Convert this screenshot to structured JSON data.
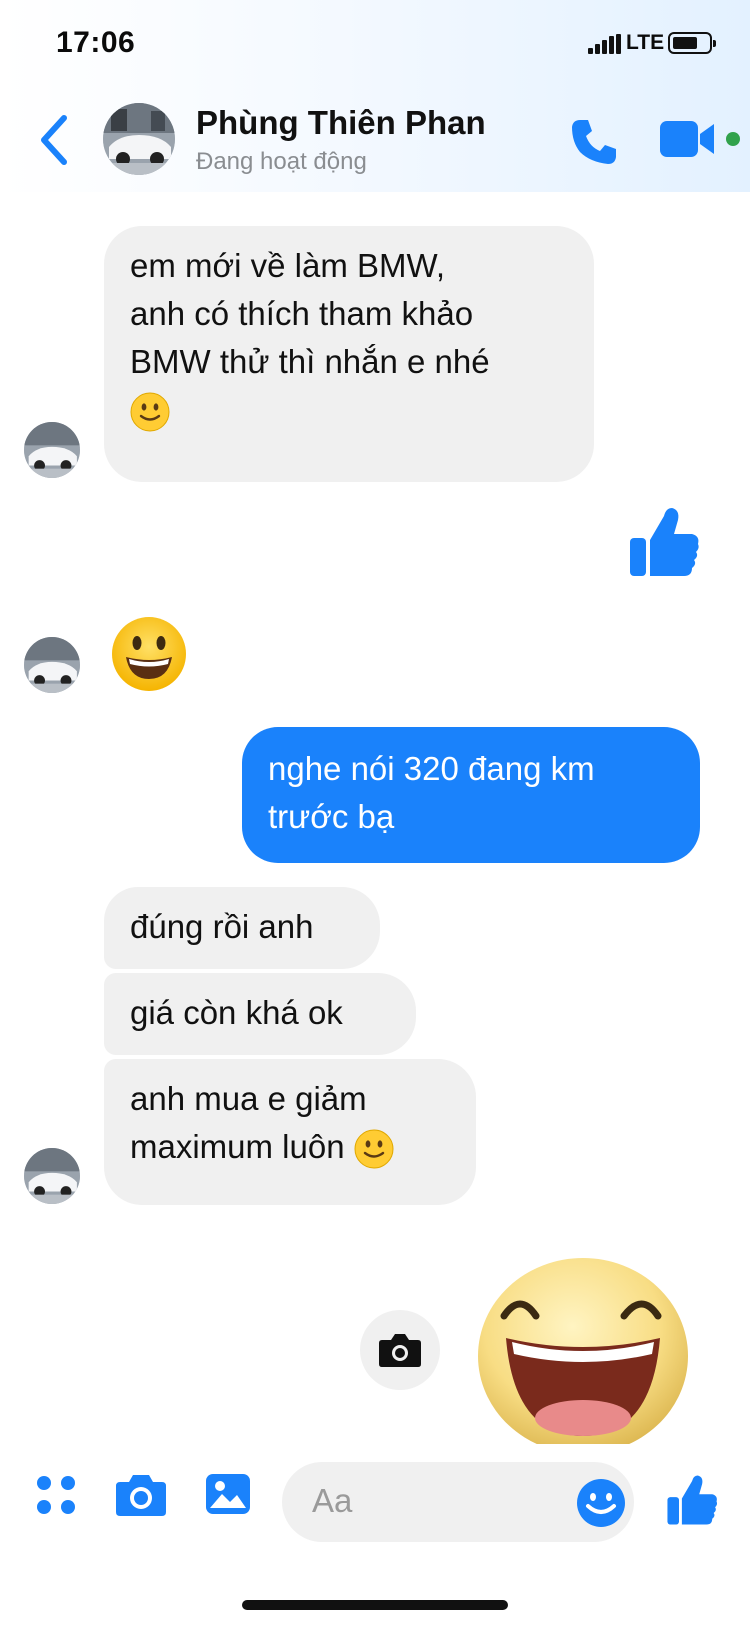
{
  "status": {
    "time": "17:06",
    "network": "LTE"
  },
  "header": {
    "contact_name": "Phùng Thiên Phan",
    "presence": "Đang hoạt động"
  },
  "messages": {
    "m1": [
      "em mới về làm BMW,",
      "anh có thích tham khảo",
      "BMW thử thì nhắn e nhé"
    ],
    "m2": [
      "nghe nói 320 đang km",
      "trước bạ"
    ],
    "m3": "đúng rồi anh",
    "m4": "giá còn khá ok",
    "m5": [
      "anh mua e giảm",
      "maximum luôn"
    ]
  },
  "composer": {
    "placeholder": "Aa"
  },
  "colors": {
    "accent": "#1a82fb",
    "incoming_bubble": "#f0f0f0",
    "online": "#31a24c"
  },
  "icons": [
    "back-chevron-icon",
    "phone-icon",
    "video-camera-icon",
    "slightly-smiling-emoji",
    "thumbs-up-icon",
    "grinning-emoji",
    "camera-icon",
    "menu-dots-icon",
    "image-icon",
    "smiley-icon",
    "laughing-sticker"
  ]
}
